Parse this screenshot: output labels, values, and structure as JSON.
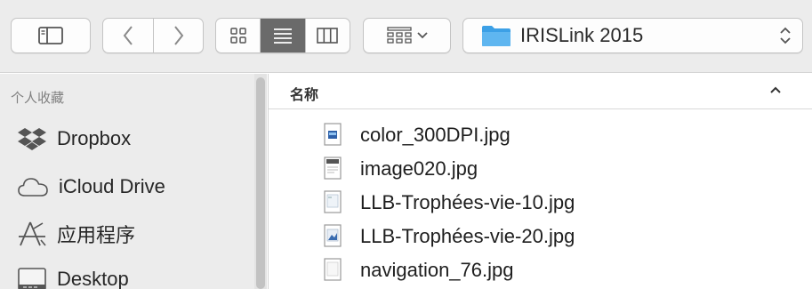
{
  "toolbar": {
    "sidebar_toggle_icon": "sidebar-icon",
    "back_icon": "chevron-left-icon",
    "forward_icon": "chevron-right-icon",
    "view_modes": [
      {
        "icon": "icon-view-icon",
        "selected": false
      },
      {
        "icon": "list-view-icon",
        "selected": true
      },
      {
        "icon": "column-view-icon",
        "selected": false
      }
    ],
    "arrange_icon": "arrange-grid-icon",
    "path": {
      "label": "IRISLink 2015",
      "folder_color": "#3ca0e6",
      "stepper_icon": "up-down-stepper-icon"
    }
  },
  "sidebar": {
    "heading": "个人收藏",
    "items": [
      {
        "label": "Dropbox",
        "icon": "dropbox-icon"
      },
      {
        "label": "iCloud Drive",
        "icon": "cloud-icon"
      },
      {
        "label": "应用程序",
        "icon": "applications-icon"
      },
      {
        "label": "Desktop",
        "icon": "desktop-icon"
      }
    ]
  },
  "file_list": {
    "column_header": "名称",
    "sort_icon": "chevron-up-icon",
    "files": [
      {
        "name": "color_300DPI.jpg",
        "icon": "jpg-thumbnail-icon"
      },
      {
        "name": "image020.jpg",
        "icon": "jpg-thumbnail-icon"
      },
      {
        "name": "LLB-Trophées-vie-10.jpg",
        "icon": "jpg-thumbnail-icon"
      },
      {
        "name": "LLB-Trophées-vie-20.jpg",
        "icon": "jpg-thumbnail-icon"
      },
      {
        "name": "navigation_76.jpg",
        "icon": "jpg-thumbnail-icon"
      }
    ]
  },
  "colors": {
    "toolbar_bg": "#ececec",
    "sidebar_bg": "#ececec",
    "active_view_bg": "#6a6a6a",
    "folder_blue": "#3ca0e6"
  }
}
